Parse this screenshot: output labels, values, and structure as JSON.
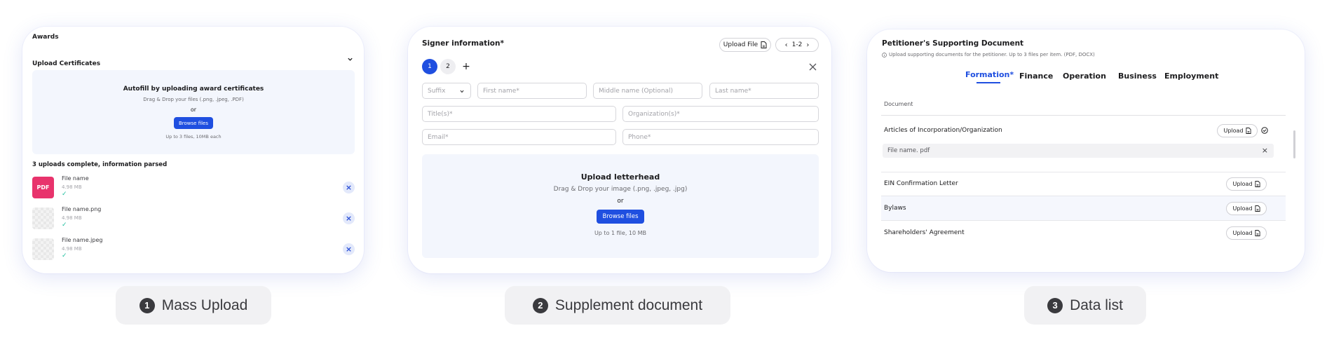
{
  "mass_upload": {
    "section_title": "Awards",
    "collapsible_title": "Upload Certificates",
    "dropzone": {
      "heading": "Autofill by uploading award certificates",
      "hint": "Drag & Drop your files (.png, .jpeg, .PDF)",
      "or": "or",
      "button": "Browse files",
      "limit": "Up to 3 files, 10MB each"
    },
    "status": "3 uploads complete, information parsed",
    "files": [
      {
        "thumb": "PDF",
        "name": "File name",
        "size": "4.98 MB"
      },
      {
        "thumb": "",
        "name": "File name.png",
        "size": "4.98 MB"
      },
      {
        "thumb": "",
        "name": "File name.jpeg",
        "size": "4.98 MB"
      }
    ]
  },
  "supplement": {
    "title": "Signer information*",
    "upload_file": "Upload File",
    "pager": "1-2",
    "steps": [
      "1",
      "2"
    ],
    "fields": {
      "suffix": "Suffix",
      "first": "First name*",
      "middle": "Middle name (Optional)",
      "last": "Last name*",
      "title": "Title(s)*",
      "org": "Organization(s)*",
      "email": "Email*",
      "phone": "Phone*"
    },
    "letterhead": {
      "heading": "Upload letterhead",
      "hint": "Drag & Drop your image (.png, .jpeg, .jpg)",
      "or": "or",
      "button": "Browse files",
      "limit": "Up to 1 file, 10 MB"
    }
  },
  "data_list": {
    "title": "Petitioner's Supporting Document",
    "subtitle": "Upload supporting documents for the petitioner. Up to 3 files per item. (PDF, DOCX)",
    "tabs": [
      "Formation*",
      "Finance",
      "Operation",
      "Business",
      "Employment"
    ],
    "column_header": "Document",
    "upload_label": "Upload",
    "attached_file": "File name. pdf",
    "documents": [
      "Articles of Incorporation/Organization",
      "EIN Confirmation Letter",
      "Bylaws",
      "Shareholders' Agreement"
    ]
  },
  "captions": [
    {
      "number": "1",
      "label": "Mass Upload"
    },
    {
      "number": "2",
      "label": "Supplement document"
    },
    {
      "number": "3",
      "label": "Data list"
    }
  ],
  "colors": {
    "primary": "#1f4fe0",
    "pdf_badge": "#e8336c",
    "check": "#1dbf9e",
    "dropzone_bg": "#f3f6fd"
  }
}
